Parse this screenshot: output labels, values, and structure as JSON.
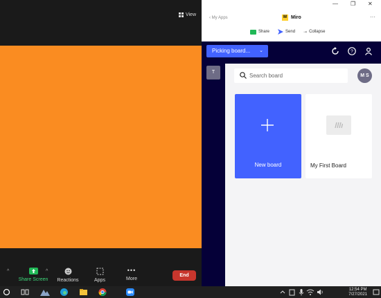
{
  "zoom": {
    "view_label": "View",
    "toolbar": {
      "share_screen": "Share Screen",
      "reactions": "Reactions",
      "apps": "Apps",
      "more": "More",
      "end": "End"
    },
    "colors": {
      "video_bg": "#fa8c21",
      "share_green": "#21b857",
      "end_red": "#c7362d"
    }
  },
  "miro": {
    "back_link": "My Apps",
    "title": "Miro",
    "actions": {
      "share": "Share",
      "send": "Send",
      "collapse": "Collapse"
    },
    "picker_label": "Picking board...",
    "team_initial": "T",
    "search_placeholder": "Search board",
    "avatar_initials": "M S",
    "new_board_label": "New board",
    "boards": [
      {
        "name": "My First Board"
      }
    ],
    "colors": {
      "accent": "#4262ff",
      "navy": "#050038"
    }
  },
  "taskbar": {
    "time": "12:54 PM",
    "date": "7/27/2021"
  }
}
